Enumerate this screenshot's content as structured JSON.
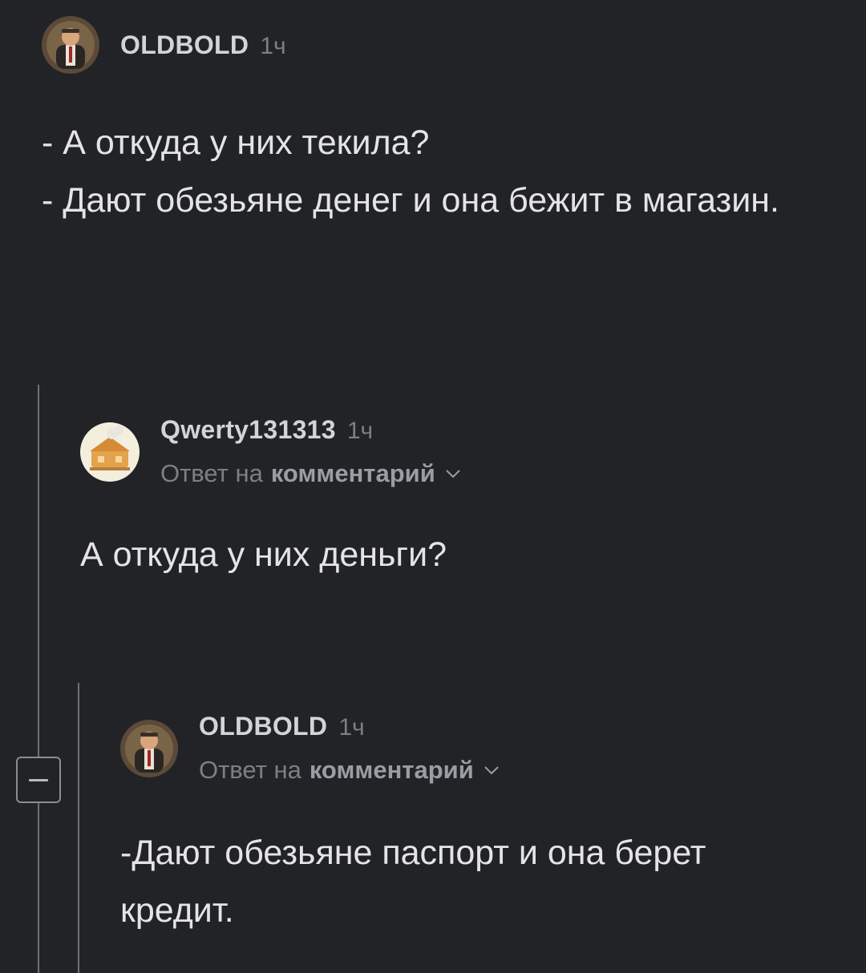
{
  "comments": [
    {
      "username": "OLDBOLD",
      "time": "1ч",
      "avatar_icon": "avatar-businessman-icon",
      "body": "- А откуда у них текила?\n- Дают обезьяне денег и она бежит в магазин."
    },
    {
      "username": "Qwerty131313",
      "time": "1ч",
      "avatar_icon": "avatar-house-icon",
      "reply_prefix": "Ответ на",
      "reply_link": "комментарий",
      "body": "А откуда у них деньги?"
    },
    {
      "username": "OLDBOLD",
      "time": "1ч",
      "avatar_icon": "avatar-businessman-icon",
      "reply_prefix": "Ответ на",
      "reply_link": "комментарий",
      "body": "-Дают обезьяне паспорт и она берет кредит."
    }
  ],
  "thread": {
    "collapse_icon": "minus-icon"
  },
  "colors": {
    "background": "#212326",
    "text": "#e4e4e4",
    "muted": "#7c7f83",
    "thread_line": "#6e7176"
  }
}
